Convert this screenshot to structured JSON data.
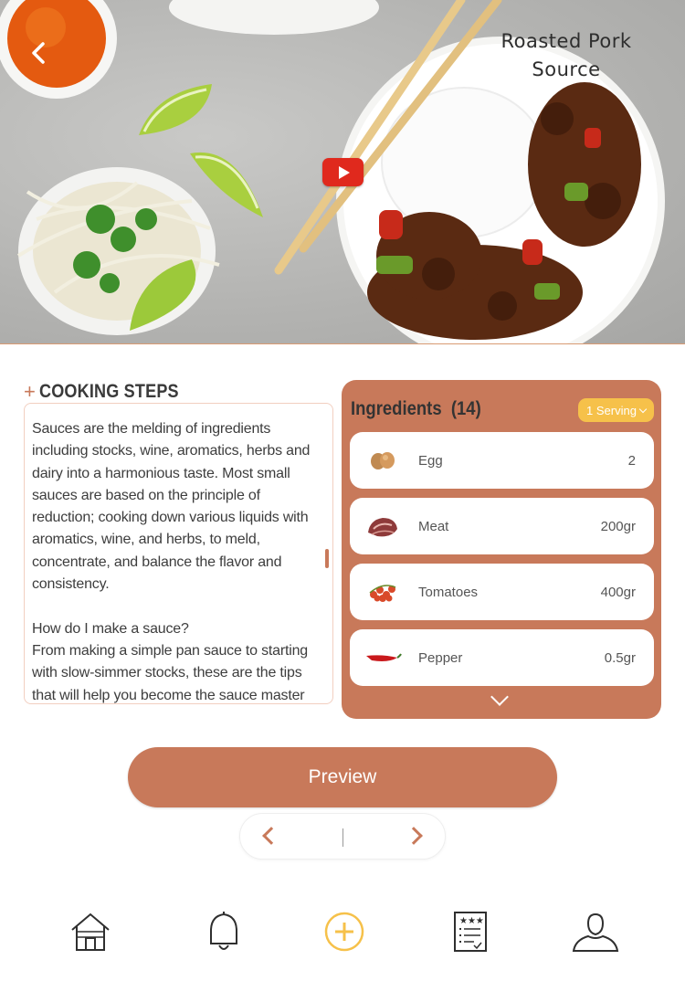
{
  "hero": {
    "title": "Roasted Pork\nSource"
  },
  "steps": {
    "plus": "+",
    "title": "COOKING STEPS",
    "body": "Sauces are the melding of ingredients including stocks, wine, aromatics, herbs and dairy into a harmonious taste. Most small sauces are based on the principle of reduction; cooking down various liquids with aromatics, wine, and herbs, to meld, concentrate, and balance the flavor and consistency.\n\nHow do I make a sauce?\nFrom making a simple pan sauce to starting with slow-simmer stocks, these are the tips that will help you become the sauce master you deserve to be."
  },
  "ingredients": {
    "title": "Ingredients  (14)",
    "serving": "1 Serving",
    "items": [
      {
        "name": "Egg",
        "qty": "2",
        "icon": "egg-icon"
      },
      {
        "name": "Meat",
        "qty": "200gr",
        "icon": "meat-icon"
      },
      {
        "name": "Tomatoes",
        "qty": "400gr",
        "icon": "tomato-icon"
      },
      {
        "name": "Pepper",
        "qty": "0.5gr",
        "icon": "chili-pepper-icon"
      }
    ]
  },
  "preview_label": "Preview",
  "nav": [
    "home-icon",
    "bell-icon",
    "add-icon",
    "recipe-list-icon",
    "profile-icon"
  ],
  "colors": {
    "accent": "#c8795a",
    "serving_badge": "#f6c14a",
    "add_icon": "#f6c14a",
    "play_button": "#e0291d"
  }
}
